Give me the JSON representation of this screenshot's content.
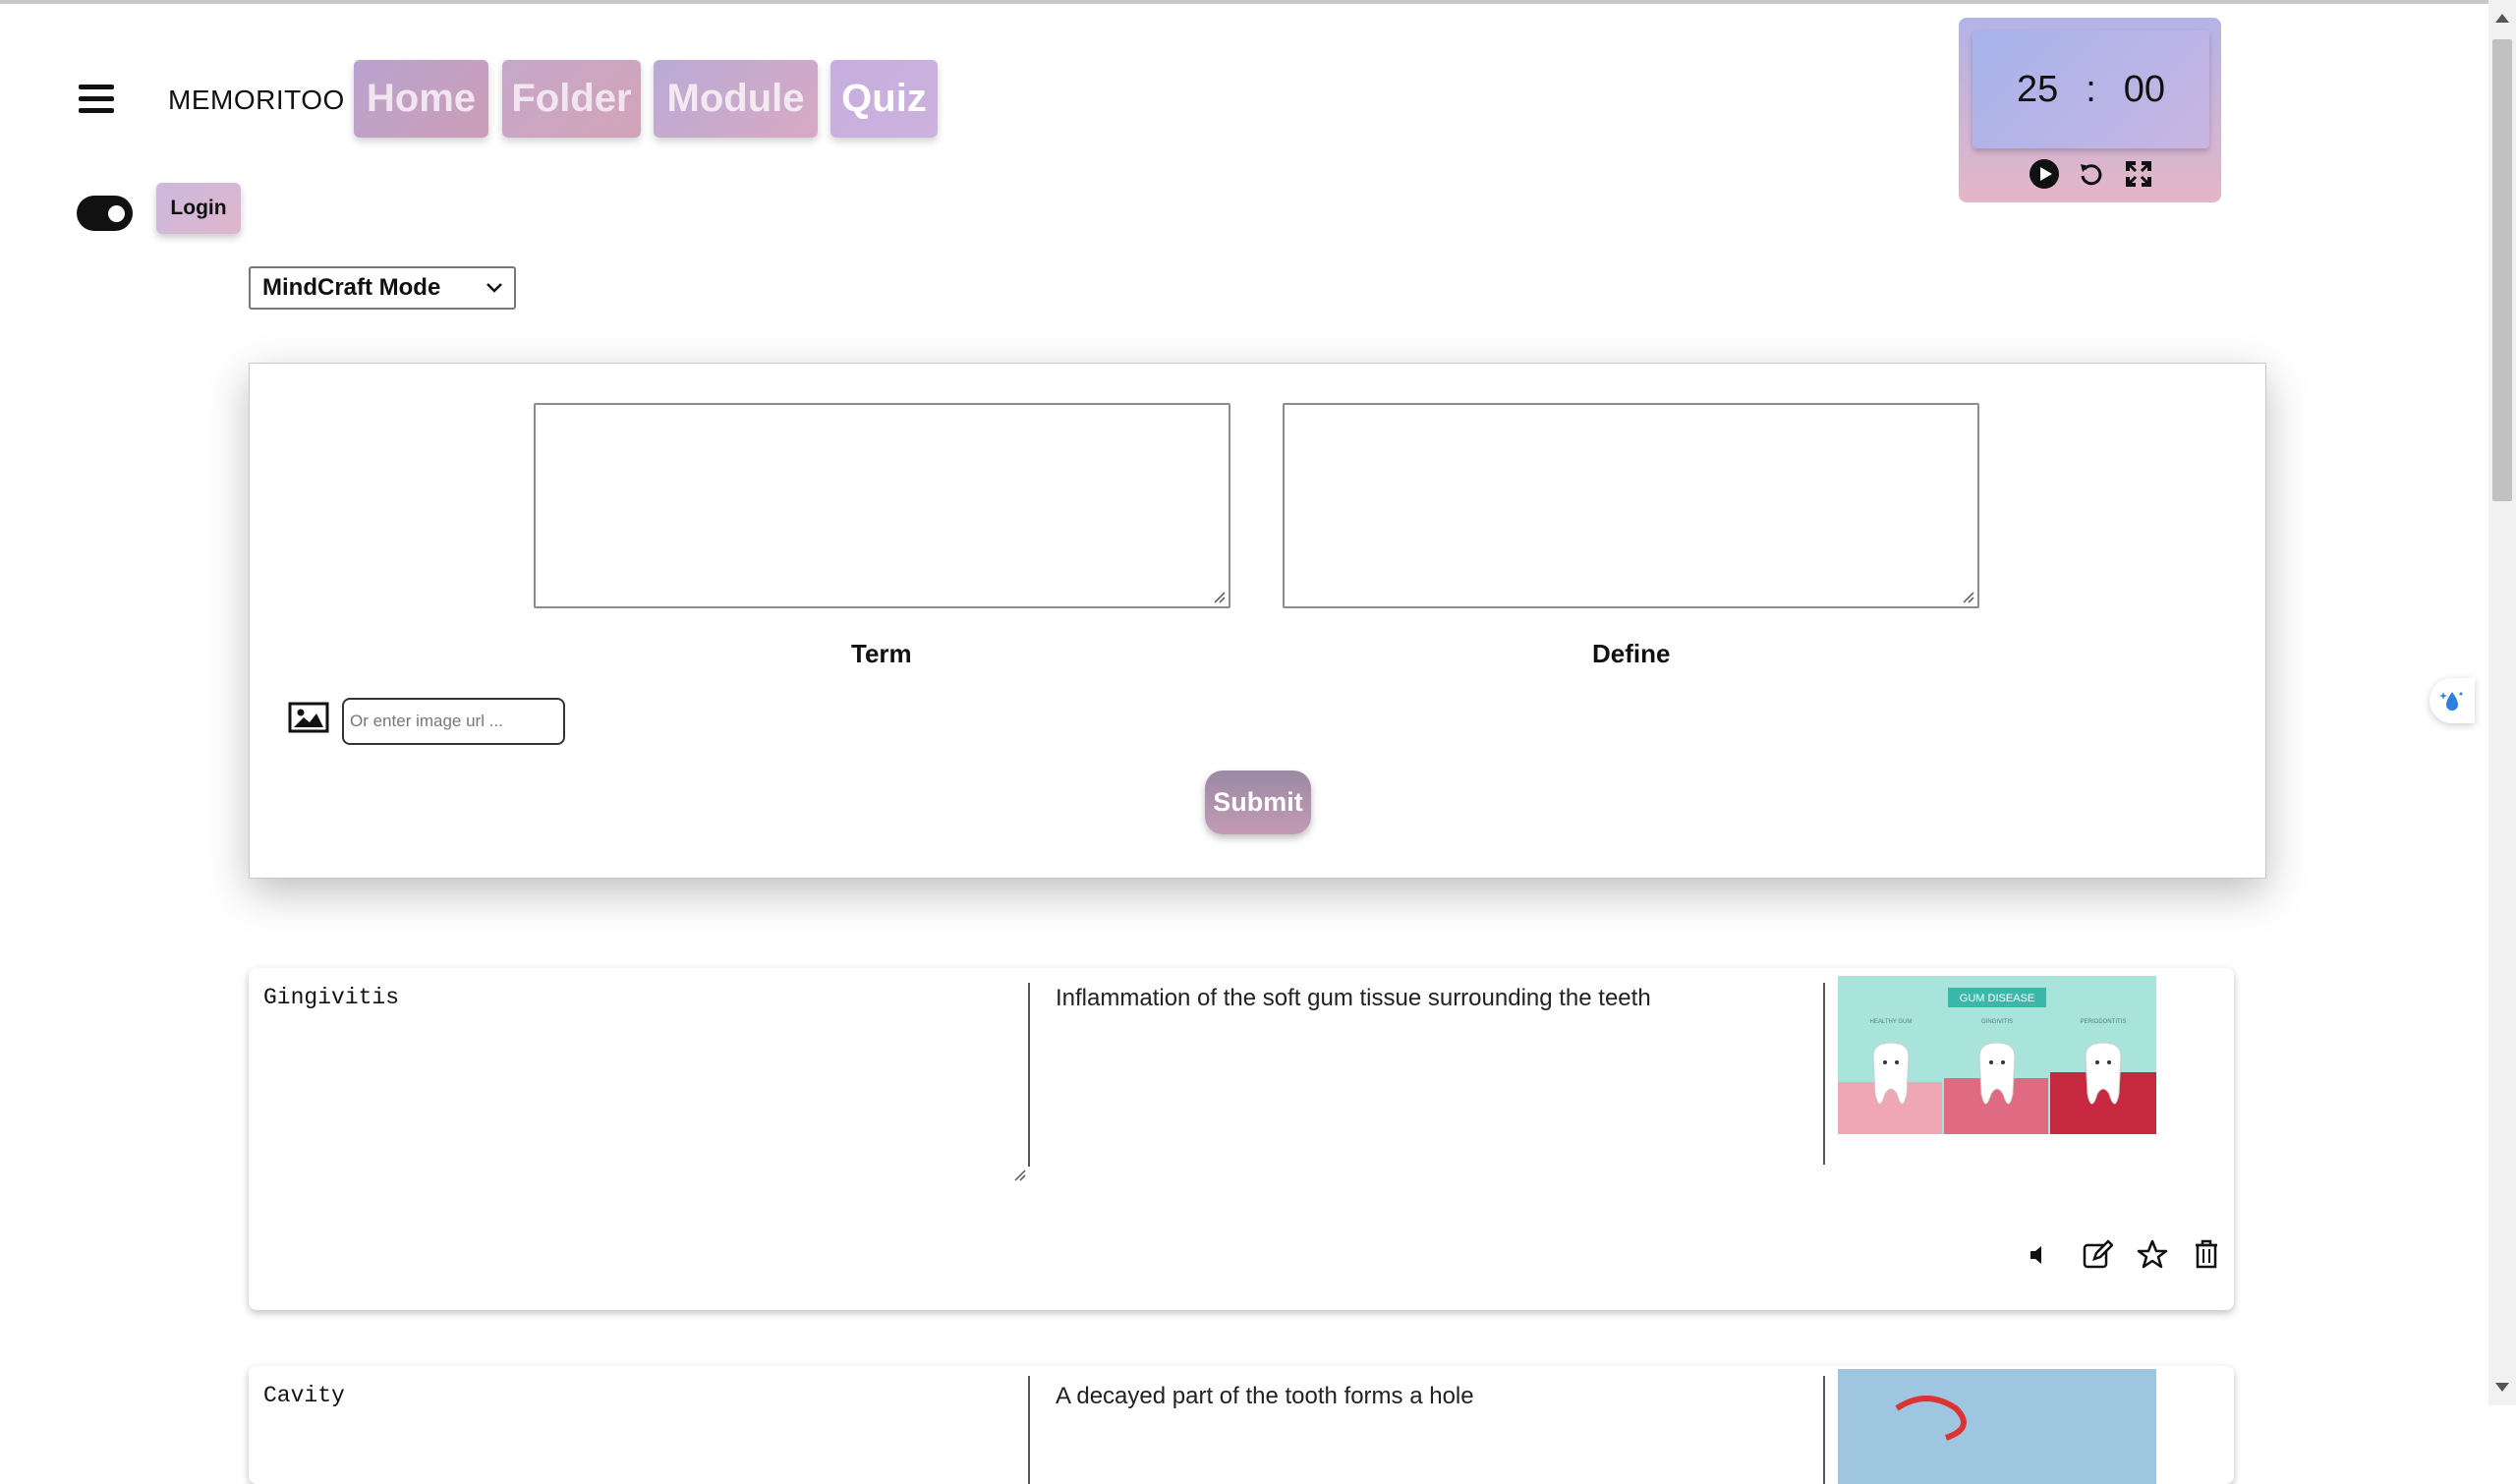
{
  "header": {
    "brand": "MEMORITOO",
    "nav": {
      "home": "Home",
      "folder": "Folder",
      "module": "Module",
      "quiz": "Quiz"
    },
    "login": "Login",
    "theme_toggle_on": true
  },
  "timer": {
    "minutes": "25",
    "separator": ":",
    "seconds": "00"
  },
  "mode_select": {
    "selected": "MindCraft Mode"
  },
  "form": {
    "term_label": "Term",
    "define_label": "Define",
    "image_url_placeholder": "Or enter image url ...",
    "submit_label": "Submit"
  },
  "cards": [
    {
      "term": "Gingivitis",
      "definition": "Inflammation of the soft gum tissue surrounding the teeth",
      "image_caption": "GUM DISEASE",
      "image_sublabels": [
        "HEALTHY GUM",
        "GINGIVITIS",
        "PERIODONTITIS"
      ]
    },
    {
      "term": "Cavity",
      "definition": "A decayed part of the tooth forms a hole"
    }
  ],
  "colors": {
    "accent_pink": "#d9a9c3",
    "accent_purple": "#b9aad6",
    "image_bg": "#a8e3dc"
  }
}
